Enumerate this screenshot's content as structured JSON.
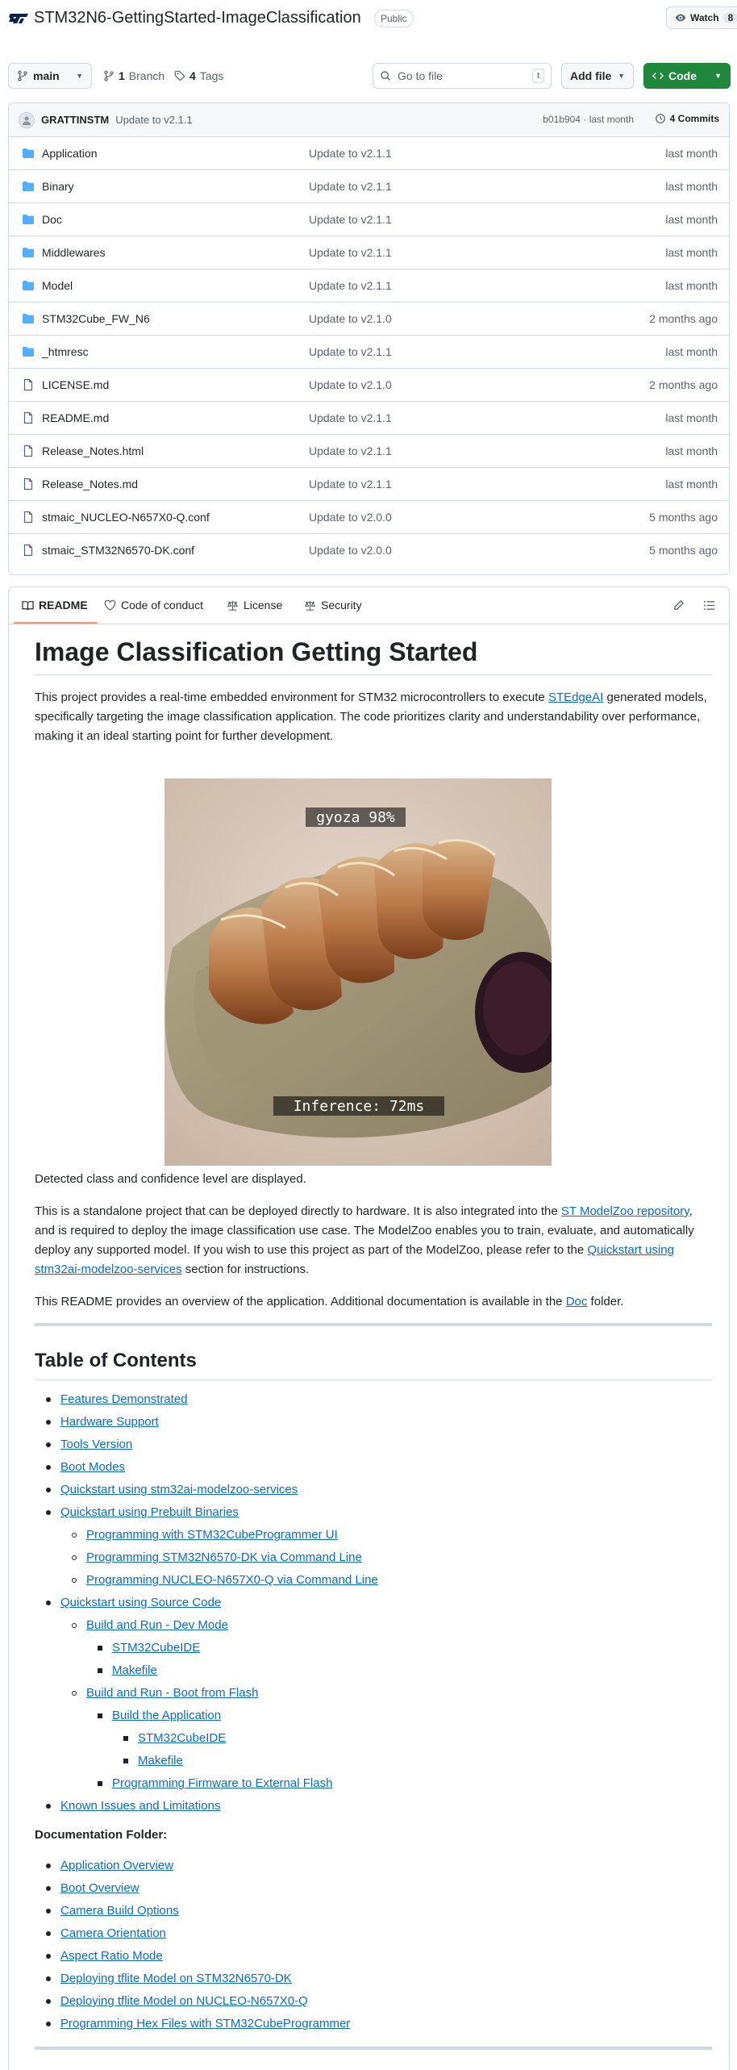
{
  "repo": {
    "title": "STM32N6-GettingStarted-ImageClassification",
    "visibility": "Public",
    "watch_label": "Watch",
    "watch_count": "8"
  },
  "toolbar": {
    "branch": "main",
    "branches_count": "1",
    "branches_label": "Branch",
    "tags_count": "4",
    "tags_label": "Tags",
    "goto_placeholder": "Go to file",
    "goto_shortcut": "t",
    "add_file_label": "Add file",
    "code_label": "Code"
  },
  "latest_commit": {
    "author": "GRATTINSTM",
    "message": "Update to v2.1.1",
    "meta": "b01b904 · last month",
    "commits_label": "4 Commits"
  },
  "files": [
    {
      "name": "Application",
      "type": "folder",
      "commit": "Update to v2.1.1",
      "age": "last month"
    },
    {
      "name": "Binary",
      "type": "folder",
      "commit": "Update to v2.1.1",
      "age": "last month"
    },
    {
      "name": "Doc",
      "type": "folder",
      "commit": "Update to v2.1.1",
      "age": "last month"
    },
    {
      "name": "Middlewares",
      "type": "folder",
      "commit": "Update to v2.1.1",
      "age": "last month"
    },
    {
      "name": "Model",
      "type": "folder",
      "commit": "Update to v2.1.1",
      "age": "last month"
    },
    {
      "name": "STM32Cube_FW_N6",
      "type": "folder",
      "commit": "Update to v2.1.0",
      "age": "2 months ago"
    },
    {
      "name": "_htmresc",
      "type": "folder",
      "commit": "Update to v2.1.1",
      "age": "last month"
    },
    {
      "name": "LICENSE.md",
      "type": "file",
      "commit": "Update to v2.1.0",
      "age": "2 months ago"
    },
    {
      "name": "README.md",
      "type": "file",
      "commit": "Update to v2.1.1",
      "age": "last month"
    },
    {
      "name": "Release_Notes.html",
      "type": "file",
      "commit": "Update to v2.1.1",
      "age": "last month"
    },
    {
      "name": "Release_Notes.md",
      "type": "file",
      "commit": "Update to v2.1.1",
      "age": "last month"
    },
    {
      "name": "stmaic_NUCLEO-N657X0-Q.conf",
      "type": "file",
      "commit": "Update to v2.0.0",
      "age": "5 months ago"
    },
    {
      "name": "stmaic_STM32N6570-DK.conf",
      "type": "file",
      "commit": "Update to v2.0.0",
      "age": "5 months ago"
    }
  ],
  "readme_tabs": [
    "README",
    "Code of conduct",
    "License",
    "Security"
  ],
  "readme": {
    "h1": "Image Classification Getting Started",
    "p1_a": "This project provides a real-time embedded environment for STM32 microcontrollers to execute ",
    "p1_link": "STEdgeAI",
    "p1_b": " generated models, specifically targeting the image classification application. The code prioritizes clarity and understandability over performance, making it an ideal starting point for further development.",
    "image_overlay_top": "gyoza 98%",
    "image_overlay_bottom": "Inference: 72ms",
    "caption": "Detected class and confidence level are displayed.",
    "p2_a": "This is a standalone project that can be deployed directly to hardware. It is also integrated into the ",
    "p2_link1": "ST ModelZoo repository",
    "p2_b": ", and is required to deploy the image classification use case. The ModelZoo enables you to train, evaluate, and automatically deploy any supported model. If you wish to use this project as part of the ModelZoo, please refer to the ",
    "p2_link2": "Quickstart using stm32ai-modelzoo-services",
    "p2_c": " section for instructions.",
    "p3_a": "This README provides an overview of the application. Additional documentation is available in the ",
    "p3_link": "Doc",
    "p3_b": " folder.",
    "toc_title": "Table of Contents",
    "toc": [
      {
        "label": "Features Demonstrated",
        "level": 0
      },
      {
        "label": "Hardware Support",
        "level": 0
      },
      {
        "label": "Tools Version",
        "level": 0
      },
      {
        "label": "Boot Modes",
        "level": 0
      },
      {
        "label": "Quickstart using stm32ai-modelzoo-services",
        "level": 0
      },
      {
        "label": "Quickstart using Prebuilt Binaries",
        "level": 0
      },
      {
        "label": "Programming with STM32CubeProgrammer UI",
        "level": 1
      },
      {
        "label": "Programming STM32N6570-DK via Command Line",
        "level": 1
      },
      {
        "label": "Programming NUCLEO-N657X0-Q via Command Line",
        "level": 1
      },
      {
        "label": "Quickstart using Source Code",
        "level": 0
      },
      {
        "label": "Build and Run - Dev Mode",
        "level": 1
      },
      {
        "label": "STM32CubeIDE",
        "level": 2
      },
      {
        "label": "Makefile",
        "level": 2
      },
      {
        "label": "Build and Run - Boot from Flash",
        "level": 1
      },
      {
        "label": "Build the Application",
        "level": 2
      },
      {
        "label": "STM32CubeIDE",
        "level": 3
      },
      {
        "label": "Makefile",
        "level": 3
      },
      {
        "label": "Programming Firmware to External Flash",
        "level": 2
      },
      {
        "label": "Known Issues and Limitations",
        "level": 0
      }
    ],
    "doc_folder_title": "Documentation Folder:",
    "doc_links": [
      "Application Overview",
      "Boot Overview",
      "Camera Build Options",
      "Camera Orientation",
      "Aspect Ratio Mode",
      "Deploying tflite Model on STM32N6570-DK",
      "Deploying tflite Model on NUCLEO-N657X0-Q",
      "Programming Hex Files with STM32CubeProgrammer"
    ]
  }
}
